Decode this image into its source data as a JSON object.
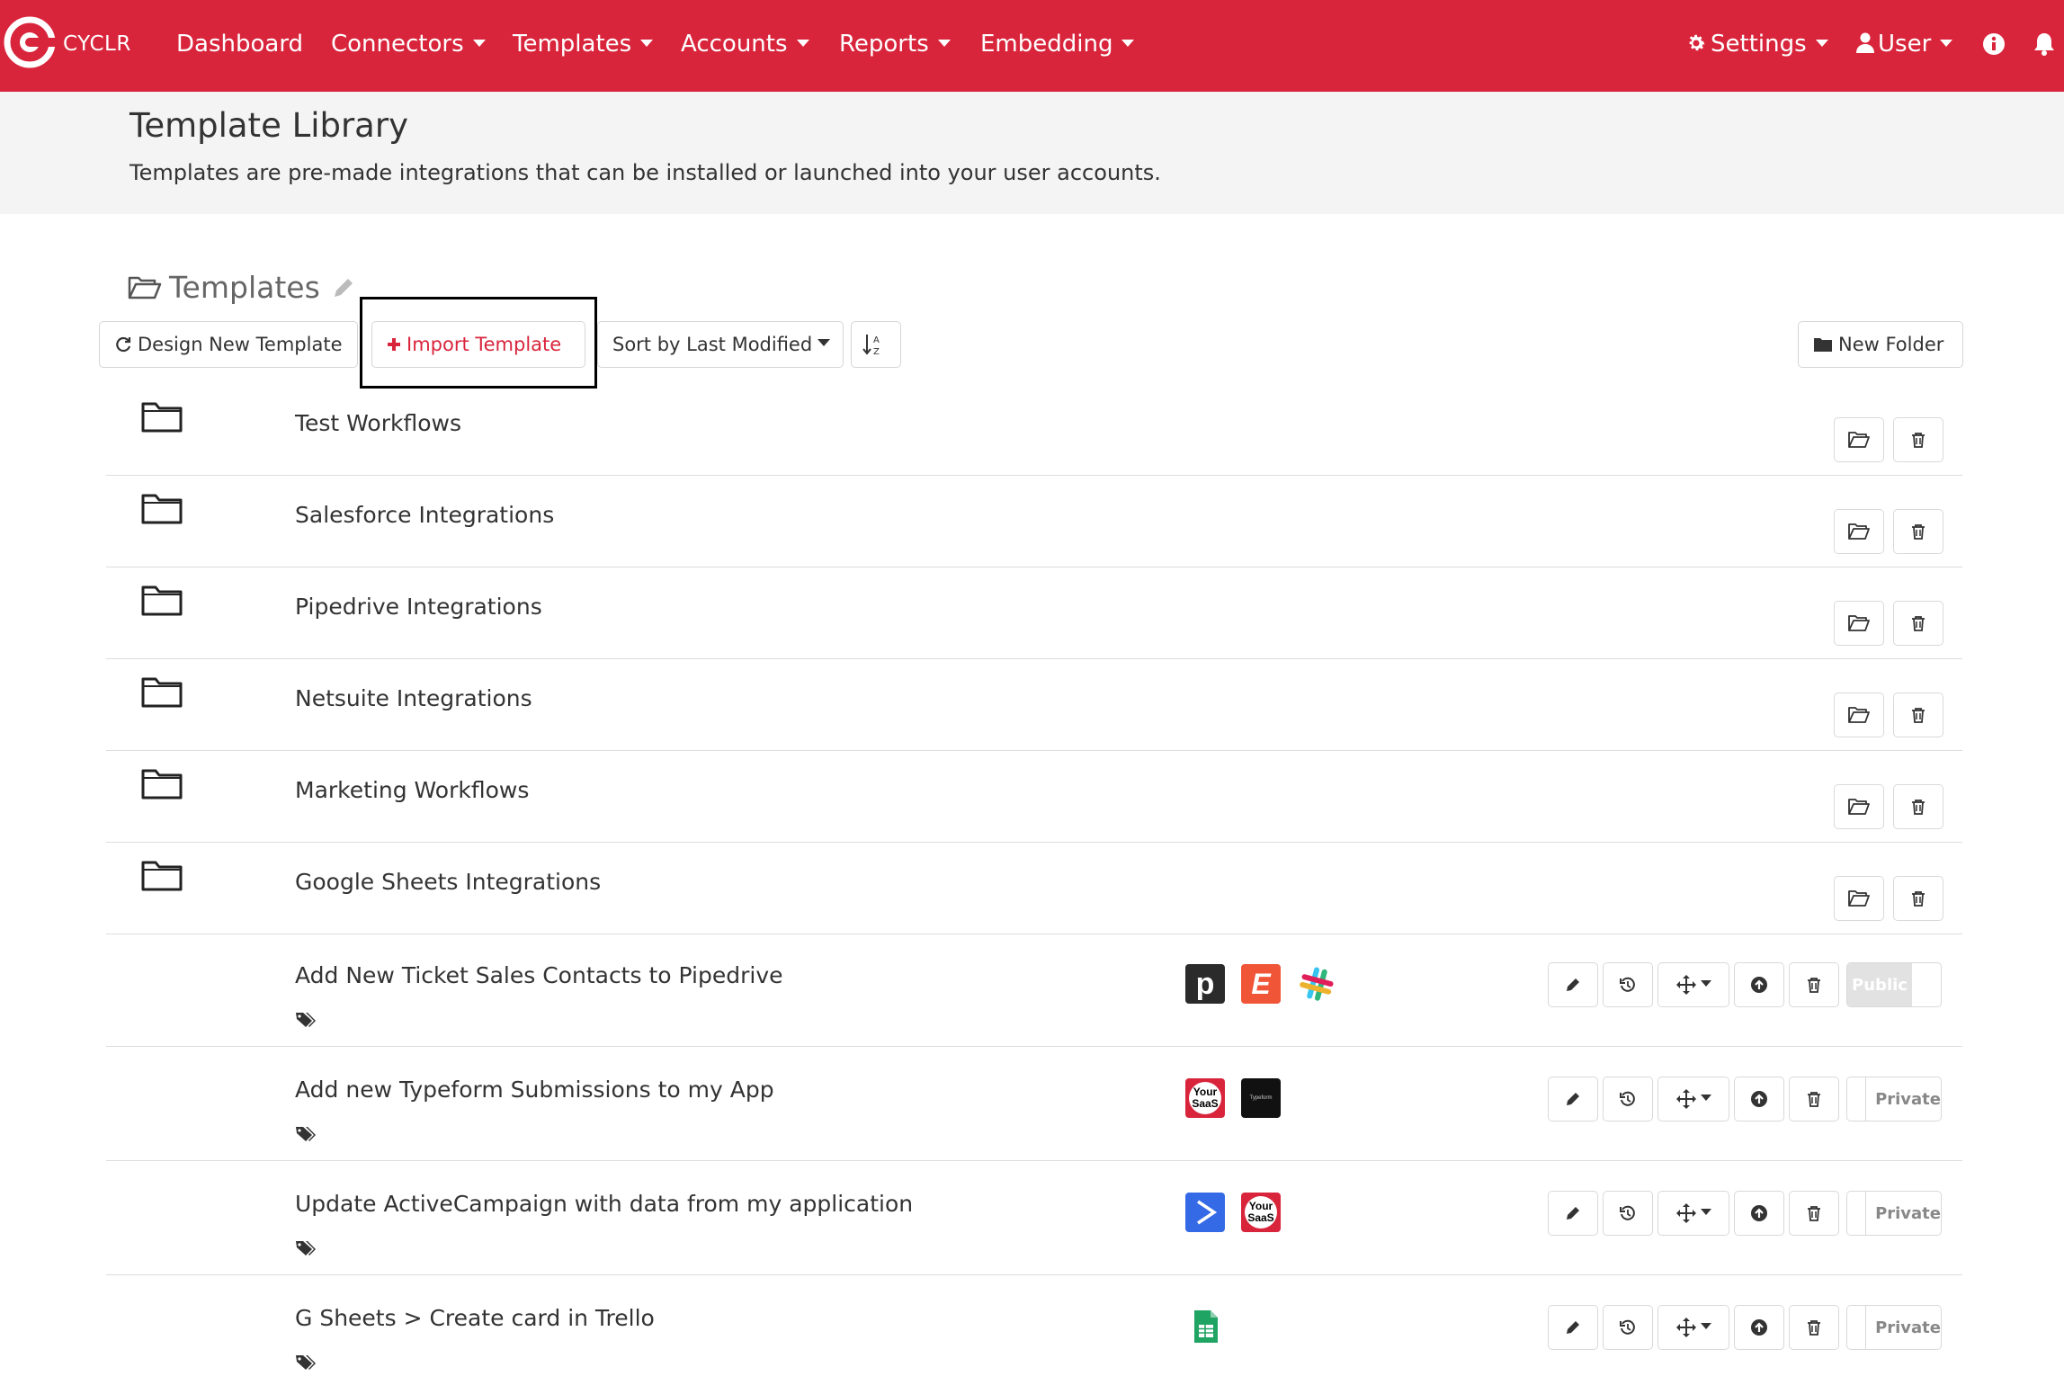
{
  "nav": {
    "brand": "CYCLR",
    "items": [
      {
        "label": "Dashboard",
        "dropdown": false
      },
      {
        "label": "Connectors",
        "dropdown": true
      },
      {
        "label": "Templates",
        "dropdown": true
      },
      {
        "label": "Accounts",
        "dropdown": true
      },
      {
        "label": "Reports",
        "dropdown": true
      },
      {
        "label": "Embedding",
        "dropdown": true
      }
    ],
    "settings_label": "Settings",
    "user_label": "User",
    "brand_color": "#d9253c"
  },
  "header": {
    "title": "Template Library",
    "description": "Templates are pre-made integrations that can be installed or launched into your user accounts."
  },
  "toolbar": {
    "folder_title": "Templates",
    "design_label": "Design New Template",
    "import_label": "Import Template",
    "sort_label": "Sort by Last Modified",
    "new_folder_label": "New Folder"
  },
  "folders": [
    {
      "name": "Test Workflows"
    },
    {
      "name": "Salesforce Integrations"
    },
    {
      "name": "Pipedrive Integrations"
    },
    {
      "name": "Netsuite Integrations"
    },
    {
      "name": "Marketing Workflows"
    },
    {
      "name": "Google Sheets Integrations"
    }
  ],
  "templates": [
    {
      "name": "Add New Ticket Sales Contacts to Pipedrive",
      "connectors": [
        "pipedrive",
        "eventbrite",
        "slack"
      ],
      "visibility": "Public"
    },
    {
      "name": "Add new Typeform Submissions to my App",
      "connectors": [
        "your-saas",
        "typeform"
      ],
      "visibility": "Private"
    },
    {
      "name": "Update ActiveCampaign with data from my application",
      "connectors": [
        "activecampaign",
        "your-saas"
      ],
      "visibility": "Private"
    },
    {
      "name": "G Sheets > Create card in Trello",
      "connectors": [
        "google-sheets"
      ],
      "visibility": "Private"
    }
  ],
  "connector_labels": {
    "your_saas_line1": "Your",
    "your_saas_line2": "SaaS",
    "typeform": "Typeform",
    "pipedrive": "p",
    "eventbrite": "E"
  }
}
